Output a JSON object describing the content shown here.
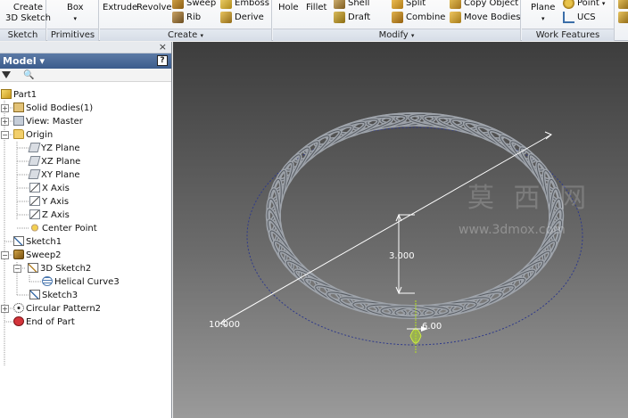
{
  "ribbon": {
    "sketch_group": {
      "title": "Sketch",
      "create_label": "Create",
      "sketch3d_label": "3D Sketch"
    },
    "primitives_group": {
      "title": "Primitives",
      "box_label": "Box"
    },
    "create_group": {
      "title": "Create",
      "extrude_label": "Extrude",
      "revolve_label": "Revolve",
      "sweep_label": "Sweep",
      "emboss_label": "Emboss",
      "rib_label": "Rib",
      "derive_label": "Derive"
    },
    "modify_group": {
      "title": "Modify",
      "hole_label": "Hole",
      "fillet_label": "Fillet",
      "shell_label": "Shell",
      "draft_label": "Draft",
      "split_label": "Split",
      "combine_label": "Combine",
      "copy_object_label": "Copy Object",
      "move_bodies_label": "Move Bodies"
    },
    "work_features_group": {
      "title": "Work Features",
      "plane_label": "Plane",
      "point_label": "Point",
      "ucs_label": "UCS"
    }
  },
  "browser": {
    "close_glyph": "×",
    "title": "Model ▾",
    "help_glyph": "?",
    "find_glyph": "🔍",
    "tree": [
      {
        "label": "Part1",
        "icon": "part-icon"
      },
      {
        "label": "Solid Bodies(1)",
        "icon": "solid-bodies-icon"
      },
      {
        "label": "View: Master",
        "icon": "view-icon"
      },
      {
        "label": "Origin",
        "icon": "folder-icon"
      },
      {
        "label": "YZ Plane",
        "icon": "plane-icon"
      },
      {
        "label": "XZ Plane",
        "icon": "plane-icon"
      },
      {
        "label": "XY Plane",
        "icon": "plane-icon"
      },
      {
        "label": "X Axis",
        "icon": "axis-icon"
      },
      {
        "label": "Y Axis",
        "icon": "axis-icon"
      },
      {
        "label": "Z Axis",
        "icon": "axis-icon"
      },
      {
        "label": "Center Point",
        "icon": "center-point-icon"
      },
      {
        "label": "Sketch1",
        "icon": "sketch-icon"
      },
      {
        "label": "Sweep2",
        "icon": "sweep-icon"
      },
      {
        "label": "3D Sketch2",
        "icon": "sketch3d-icon"
      },
      {
        "label": "Helical Curve3",
        "icon": "helix-icon"
      },
      {
        "label": "Sketch3",
        "icon": "sketch-icon"
      },
      {
        "label": "Circular Pattern2",
        "icon": "circular-pattern-icon"
      },
      {
        "label": "End of Part",
        "icon": "end-of-part-icon"
      }
    ]
  },
  "viewport": {
    "dimensions": {
      "diameter_outer": "10.000",
      "height": "3.000",
      "diameter_small": "6.00"
    },
    "watermark": {
      "chinese": "莫 西 网",
      "url": "www.3dmox.com"
    },
    "colors": {
      "background_top": "#3d3d3d",
      "background_bottom": "#9a9a9a",
      "coil": "#9ea3aa",
      "dimension": "#ffffff"
    }
  }
}
